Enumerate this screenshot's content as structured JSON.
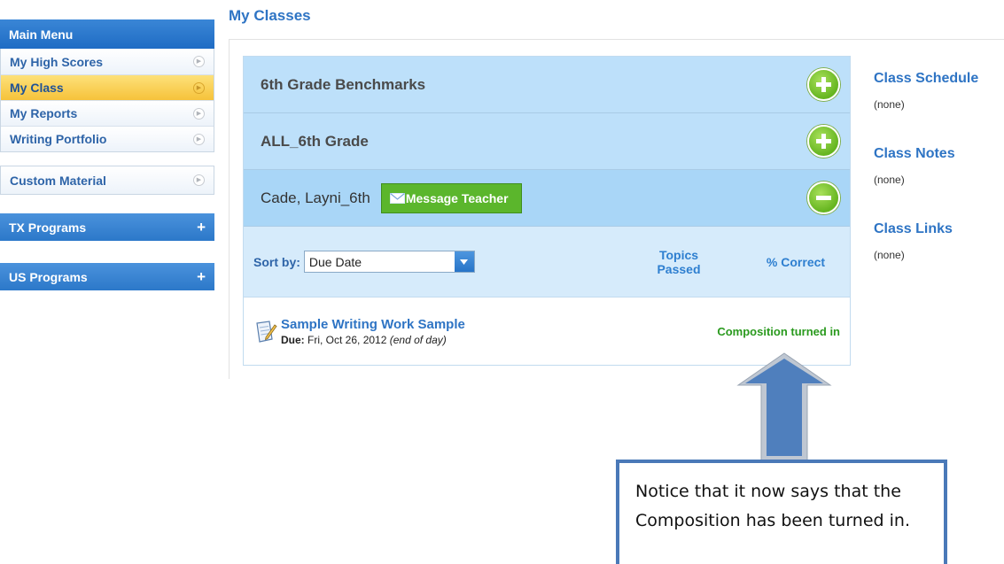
{
  "sidebar": {
    "header": "Main Menu",
    "items": [
      {
        "label": "My High Scores"
      },
      {
        "label": "My Class"
      },
      {
        "label": "My Reports"
      },
      {
        "label": "Writing Portfolio"
      }
    ],
    "custom_material": "Custom Material",
    "programs": [
      {
        "label": "TX Programs"
      },
      {
        "label": "US Programs"
      }
    ]
  },
  "page": {
    "title": "My Classes"
  },
  "classes": [
    {
      "name": "6th Grade Benchmarks",
      "expanded": false
    },
    {
      "name": "ALL_6th Grade",
      "expanded": false
    },
    {
      "name": "Cade, Layni_6th",
      "expanded": true
    }
  ],
  "message_button": "Message Teacher",
  "sort": {
    "label": "Sort by:",
    "selected": "Due Date",
    "col_topics_line1": "Topics",
    "col_topics_line2": "Passed",
    "col_correct": "% Correct"
  },
  "assignment": {
    "title": "Sample Writing Work Sample",
    "due_label": "Due:",
    "due_date": "Fri, Oct 26, 2012",
    "due_note": "(end of day)",
    "status": "Composition turned in"
  },
  "right_panel": {
    "schedule_title": "Class Schedule",
    "schedule_value": "(none)",
    "notes_title": "Class Notes",
    "notes_value": "(none)",
    "links_title": "Class Links",
    "links_value": "(none)"
  },
  "annotation": {
    "line1": "Notice that it now says that the",
    "line2": "Composition has been turned in."
  },
  "colors": {
    "accent_blue": "#2e74c4",
    "active_yellow": "#f6c23a",
    "success_green": "#2a9a1e",
    "button_green": "#5bb62c",
    "annotation_blue": "#4a79b8"
  }
}
